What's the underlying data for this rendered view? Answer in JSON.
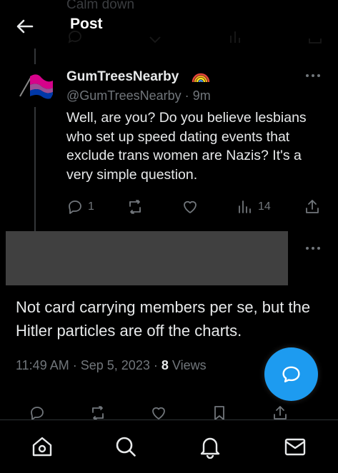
{
  "background_prev": {
    "text": "Calm down"
  },
  "header": {
    "title": "Post"
  },
  "reply_tweet": {
    "display_name": "GumTreesNearby",
    "handle": "@GumTreesNearby",
    "separator": "·",
    "time": "9m",
    "text": "Well, are you? Do you believe lesbians who set up speed dating events that exclude trans women are Nazis? It's a very simple question.",
    "reply_count": "1",
    "view_count": "14"
  },
  "main_tweet": {
    "text": "Not card carrying members per se, but the Hitler particles are off the charts.",
    "time": "11:49 AM",
    "separator": "·",
    "date": "Sep 5, 2023",
    "separator2": "·",
    "views_count": "8",
    "views_label": "Views"
  },
  "colors": {
    "background": "#000000",
    "text": "#e7e9ea",
    "muted": "#71767b",
    "accent": "#1d9bf0",
    "redaction": "#404040"
  },
  "icons": {
    "back": "arrow-left-icon",
    "more": "more-horizontal-icon",
    "reply": "reply-icon",
    "repost": "repost-icon",
    "like": "heart-icon",
    "views": "bar-chart-icon",
    "share": "share-icon",
    "bookmark": "bookmark-icon",
    "compose": "compose-reply-icon",
    "nav": [
      "home-icon",
      "search-icon",
      "bell-icon",
      "mail-icon"
    ]
  }
}
